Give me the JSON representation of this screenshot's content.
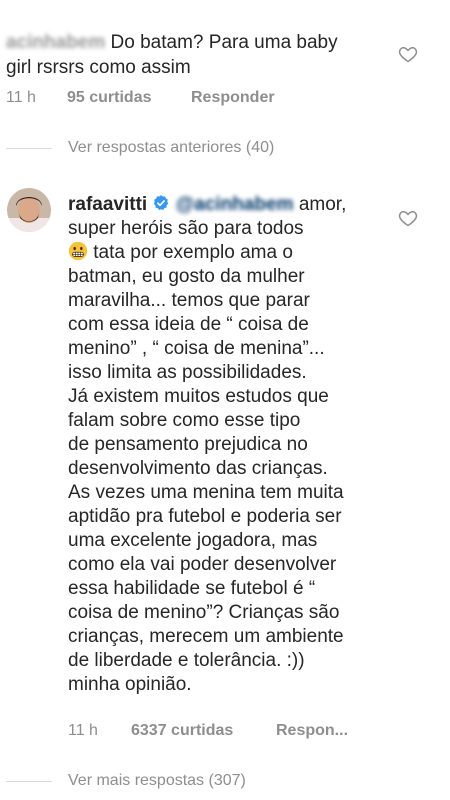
{
  "comment1": {
    "username": "acinhabem",
    "text_line1": "Do batam? Para uma baby",
    "text_line2": "girl rsrsrs como assim",
    "time": "11 h",
    "likes": "95 curtidas",
    "reply": "Responder"
  },
  "view_previous": "Ver respostas anteriores (40)",
  "comment2": {
    "username": "rafaavitti",
    "mention": "@acinhabem",
    "lines": [
      "amor,",
      "super heróis são para todos",
      "tata por exemplo ama o",
      "batman, eu gosto da mulher",
      "maravilha... temos que parar",
      "com essa ideia de “ coisa de",
      "menino” , “ coisa de menina”...",
      "isso limita as possibilidades.",
      "Já existem muitos estudos que",
      "falam sobre como esse tipo",
      "de pensamento prejudica no",
      "desenvolvimento das crianças.",
      "As vezes uma menina tem muita",
      "aptidão pra futebol e poderia ser",
      "uma excelente jogadora, mas",
      "como ela vai poder desenvolver",
      "essa habilidade se futebol  é “",
      "coisa de menino”? Crianças são",
      "crianças, merecem um ambiente",
      "de liberdade e tolerância. :))",
      "minha opinião."
    ],
    "time": "11 h",
    "likes": "6337 curtidas",
    "reply": "Respon..."
  },
  "view_more": "Ver mais respostas (307)",
  "colors": {
    "text": "#262626",
    "meta": "#8e8e8e",
    "verified": "#3897f0",
    "mention": "#00376b"
  },
  "icons": [
    "heart-icon",
    "verified-badge-icon",
    "grimacing-emoji-icon",
    "avatar"
  ]
}
